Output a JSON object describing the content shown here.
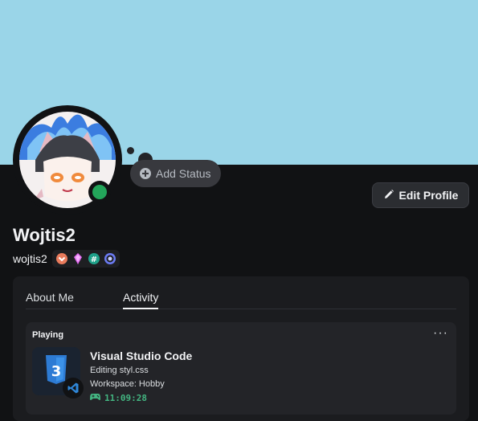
{
  "profile": {
    "display_name": "Wojtis2",
    "username": "wojtis2",
    "status": "online",
    "add_status_label": "Add Status",
    "edit_profile_label": "Edit Profile",
    "badges": [
      "nitro-icon",
      "boost-icon",
      "hashtag-icon",
      "quest-icon"
    ],
    "colors": {
      "banner": "#9ad5e8",
      "online": "#23a55a"
    }
  },
  "tabs": [
    {
      "label": "About Me",
      "active": false
    },
    {
      "label": "Activity",
      "active": true
    }
  ],
  "activity": {
    "header": "Playing",
    "more_label": "···",
    "game_title": "Visual Studio Code",
    "detail_1": "Editing styl.css",
    "detail_2": "Workspace: Hobby",
    "elapsed": "11:09:28",
    "large_image": "css3-icon",
    "small_image": "vscode-icon"
  }
}
